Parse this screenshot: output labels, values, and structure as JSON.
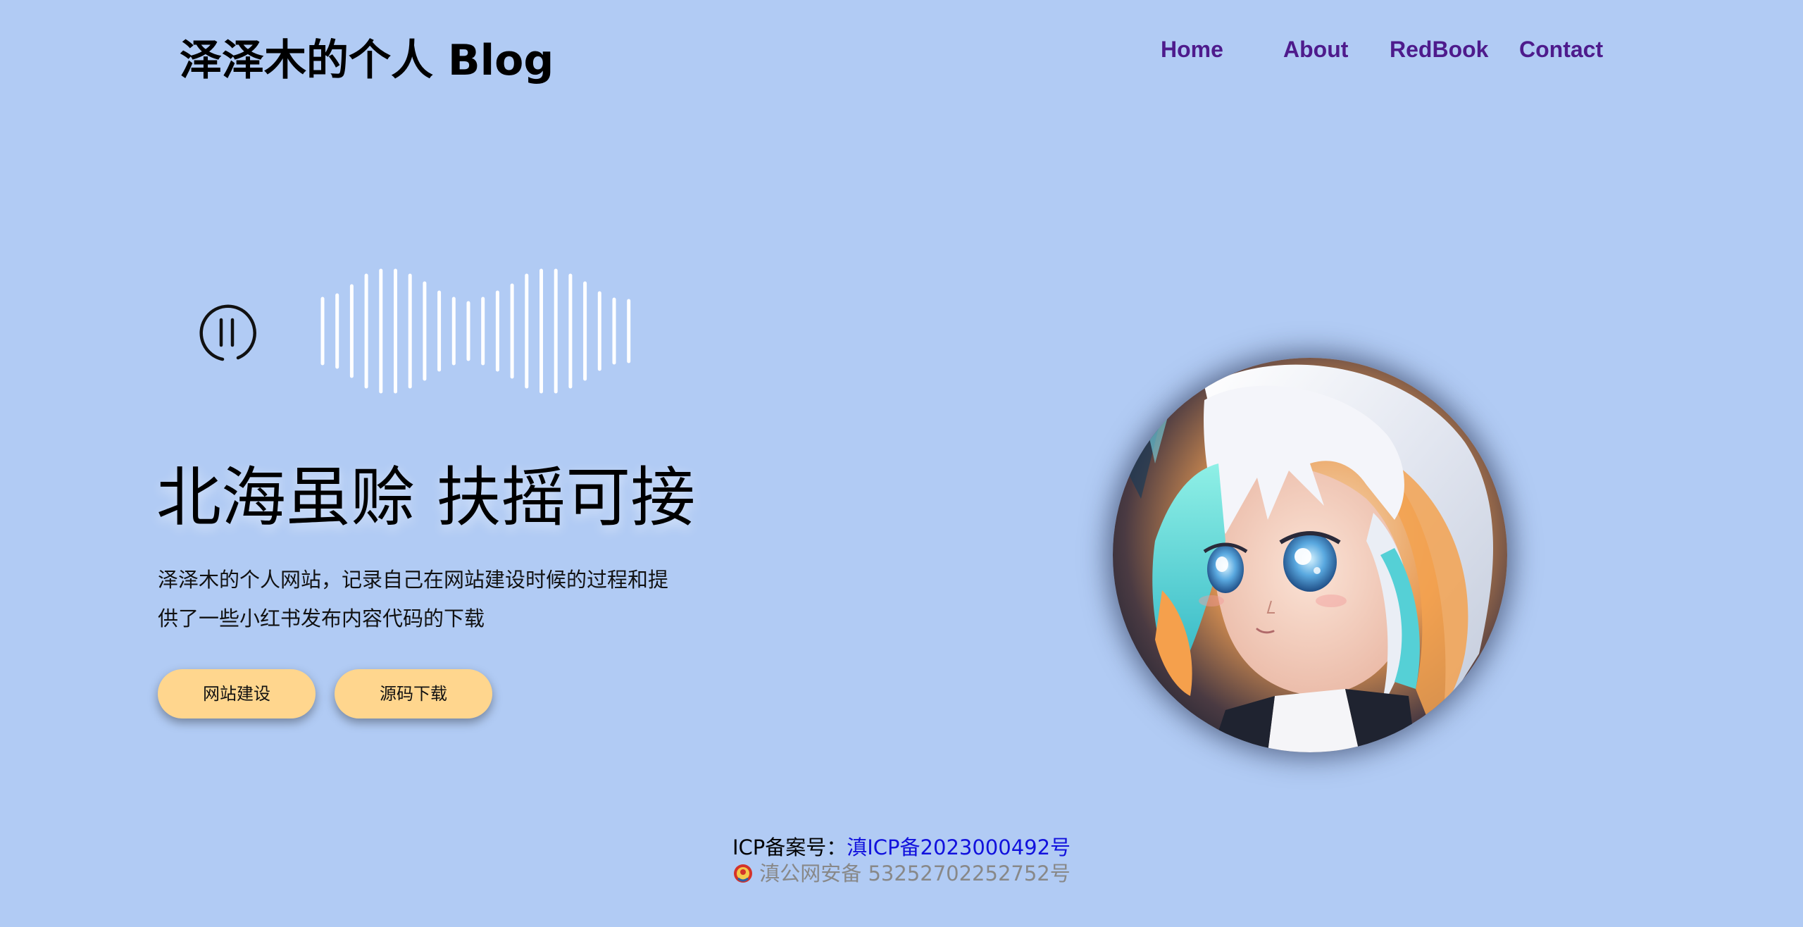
{
  "header": {
    "site_title": "泽泽木的个人 Blog"
  },
  "nav": {
    "items": [
      "Home",
      "About",
      "RedBook",
      "Contact"
    ],
    "color": "#4e1b8c"
  },
  "player": {
    "state": "playing",
    "control_icon": "pause-circle-icon",
    "waveform_icon": "audio-waveform-icon"
  },
  "hero": {
    "slogan": "北海虽赊 扶摇可接",
    "description": "泽泽木的个人网站，记录自己在网站建设时候的过程和提供了一些小红书发布内容代码的下载",
    "buttons": [
      "网站建设",
      "源码下载"
    ],
    "button_color": "#ffd68e"
  },
  "avatar": {
    "icon": "anime-avatar-portrait"
  },
  "footer": {
    "icp_label": "ICP备案号：",
    "icp_number": "滇ICP备2023000492号",
    "police_icon": "police-badge-icon",
    "police_record": "滇公网安备 53252702252752号"
  },
  "colors": {
    "background": "#b1cbf4",
    "link": "#1111dd"
  }
}
